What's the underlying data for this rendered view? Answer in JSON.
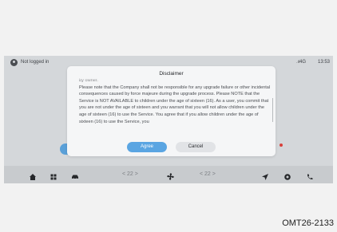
{
  "statusbar": {
    "user_label": "Not logged in",
    "signal": "4G",
    "time": "13:53"
  },
  "taskbar": {
    "left_temp": "< 22 >",
    "right_temp": "< 22 >",
    "icons": [
      "home-icon",
      "apps-grid-icon",
      "car-icon",
      "fan-icon",
      "navigation-icon",
      "settings-icon",
      "phone-icon"
    ]
  },
  "dialog": {
    "title": "Disclaimer",
    "body": "by owner.\nPlease note that the Company shall not be responsible for any upgrade failure or other incidental consequences caused by force majeure during the upgrade process. Please NOTE that the Service is NOT AVAILABLE to children under the age of sixteen (16). As a user, you commit that you are not under the age of sixteen and you warrant that you will not allow children under the age of sixteen (16) to use the Service. You agree that if you allow children under the age of sixteen (16) to use the Service, you",
    "agree_label": "Agree",
    "cancel_label": "Cancel"
  },
  "colors": {
    "accent": "#5aa5e2",
    "screen_bg": "#d4d7da",
    "alert_dot": "#d8403a"
  },
  "caption": "OMT26-2133"
}
